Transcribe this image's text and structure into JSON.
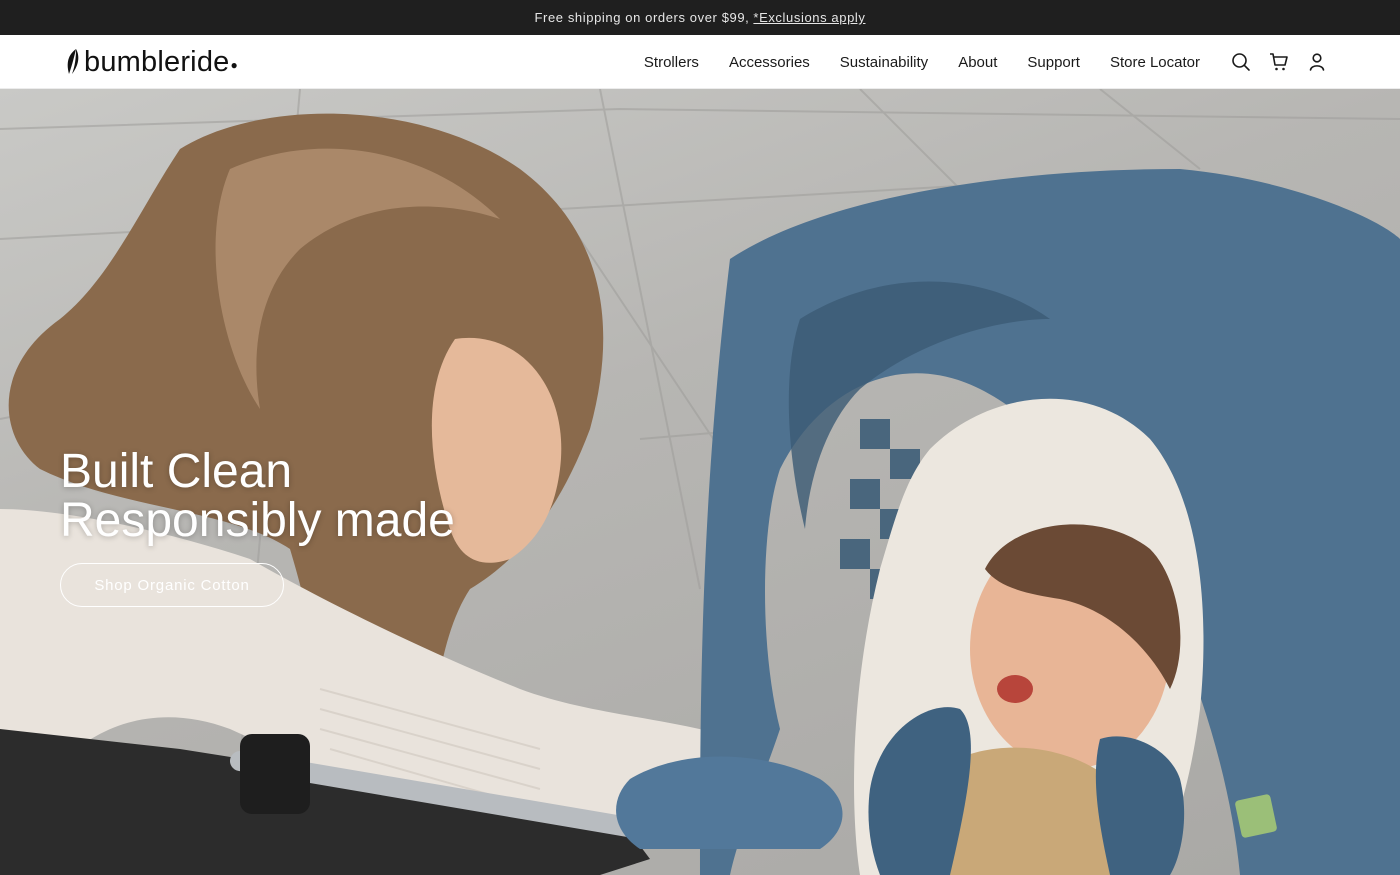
{
  "announcement": {
    "text": "Free shipping on orders over $99,",
    "link": "*Exclusions apply"
  },
  "header": {
    "logo": "bumbleride",
    "nav": [
      {
        "label": "Strollers"
      },
      {
        "label": "Accessories"
      },
      {
        "label": "Sustainability"
      },
      {
        "label": "About"
      },
      {
        "label": "Support"
      },
      {
        "label": "Store Locator"
      }
    ],
    "icons": [
      "search-icon",
      "cart-icon",
      "account-icon"
    ]
  },
  "hero": {
    "title_line1": "Built Clean",
    "title_line2": "Responsibly made",
    "cta_label": "Shop Organic Cotton"
  },
  "colors": {
    "announcement_bg": "#1f1f1f",
    "canopy_blue": "#4f7290",
    "text_dark": "#1a1a1a"
  }
}
